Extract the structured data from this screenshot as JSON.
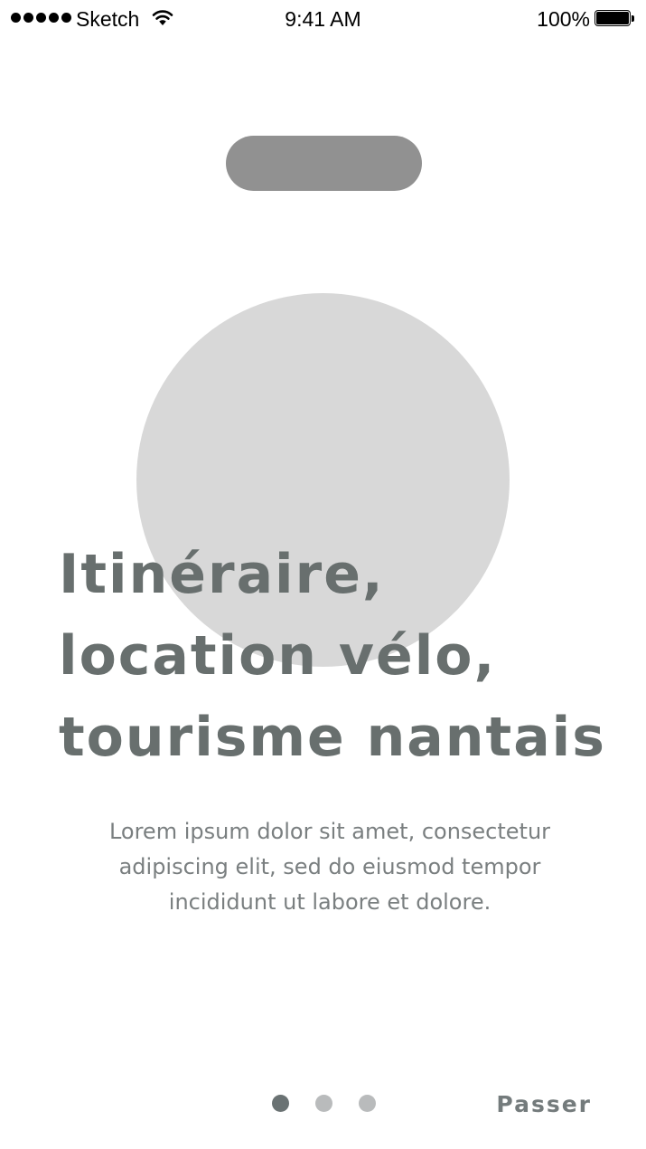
{
  "status_bar": {
    "carrier": "Sketch",
    "time": "9:41 AM",
    "battery_percent": "100%",
    "battery_level": 1.0,
    "signal_bars": 5,
    "icons": [
      "signal-dots-icon",
      "wifi-icon",
      "battery-icon"
    ]
  },
  "onboarding": {
    "headline_lines": [
      "Itinéraire,",
      "location vélo,",
      "tourisme nantais"
    ],
    "body": "Lorem ipsum dolor sit amet, consectetur adipiscing elit, sed do eiusmod tempor incididunt ut labore et dolore.",
    "pager": {
      "total_pages": 3,
      "current_page": 1
    },
    "skip_label": "Passer"
  },
  "colors": {
    "pill": "#919191",
    "illustration": "#d8d8d8",
    "headline": "#686f6e",
    "body_text": "#7a7f80",
    "dot_active": "#6a7273",
    "dot_inactive": "#b9bbbc"
  }
}
